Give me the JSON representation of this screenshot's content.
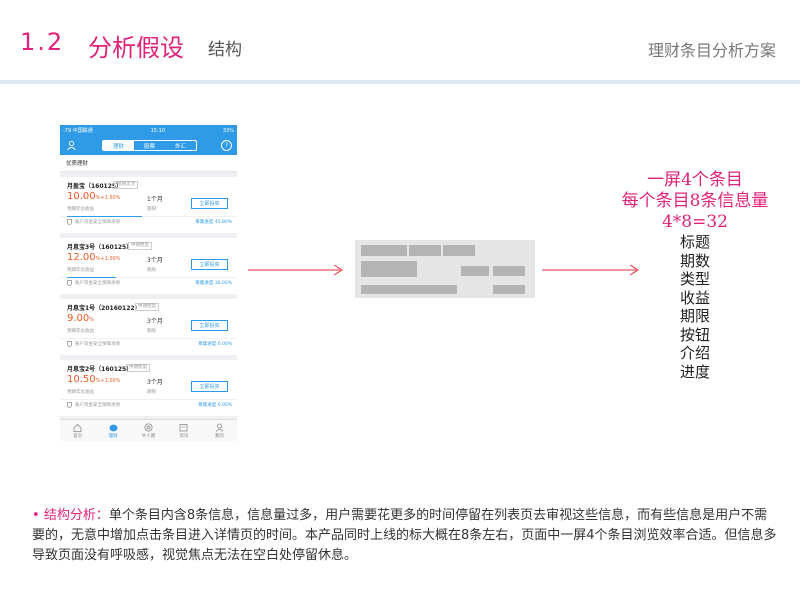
{
  "header": {
    "number": "1.2",
    "title": "分析假设",
    "subtitle": "结构",
    "deck_name": "理财条目分析方案",
    "accent_color": "#e0237a"
  },
  "phone": {
    "status_bar": {
      "carrier": "-79 中国联通",
      "time": "15:10",
      "battery": "33%"
    },
    "tabs": [
      {
        "label": "理财",
        "active": true
      },
      {
        "label": "股票",
        "active": false
      },
      {
        "label": "外汇",
        "active": false
      }
    ],
    "help_icon_text": "?",
    "section_title": "优质理财",
    "products": [
      {
        "name": "月盈宝（160125）",
        "tag": "短期灵活",
        "rate": "10.00",
        "rate_extra": "%+1.50%",
        "rate_label": "预期年化收益",
        "period": "1个月",
        "period_label": "期限",
        "button": "立即投资",
        "insurance": "账户资金安全保障承保",
        "progress": "筹集进度 45.80%",
        "progress_value": 0.458
      },
      {
        "name": "月息宝3号（160125）",
        "tag": "中期稳盈",
        "rate": "12.00",
        "rate_extra": "%+1.00%",
        "rate_label": "预期年化收益",
        "period": "3个月",
        "period_label": "期限",
        "button": "立即投资",
        "insurance": "账户资金安全保障承保",
        "progress": "筹集进度 30.00%",
        "progress_value": 0.3
      },
      {
        "name": "月息宝1号（20160122）",
        "tag": "中期稳盈",
        "rate": "9.00",
        "rate_extra": "%",
        "rate_label": "预期年化收益",
        "period": "3个月",
        "period_label": "期限",
        "button": "立即投资",
        "insurance": "账户资金安全保障承保",
        "progress": "筹集进度 0.00%",
        "progress_value": 0.0
      },
      {
        "name": "月息宝2号（160125）",
        "tag": "中期稳盈",
        "rate": "10.50",
        "rate_extra": "%+1.00%",
        "rate_label": "预期年化收益",
        "period": "3个月",
        "period_label": "期限",
        "button": "立即投资",
        "insurance": "账户资金安全保障承保",
        "progress": "筹集进度 0.00%",
        "progress_value": 0.0
      }
    ],
    "tabbar": [
      {
        "label": "首页",
        "icon": "home-icon",
        "active": false
      },
      {
        "label": "理财",
        "icon": "piggy-bank-icon",
        "active": true
      },
      {
        "label": "牛人圈",
        "icon": "circle-icon",
        "active": false
      },
      {
        "label": "资讯",
        "icon": "news-icon",
        "active": false
      },
      {
        "label": "我的",
        "icon": "user-icon",
        "active": false
      }
    ],
    "brand_color": "#2f9be6",
    "rate_color": "#f15a24"
  },
  "annotation": {
    "line1": "一屏4个条目",
    "line2": "每个条目8条信息量",
    "line3": "4*8=32",
    "fields": [
      "标题",
      "期数",
      "类型",
      "收益",
      "期限",
      "按钮",
      "介绍",
      "进度"
    ]
  },
  "analysis": {
    "bullet": "•",
    "label": "结构分析：",
    "text": "单个条目内含8条信息，信息量过多，用户需要花更多的时间停留在列表页去审视这些信息，而有些信息是用户不需要的，无意中增加点击条目进入详情页的时间。本产品同时上线的标大概在8条左右，页面中一屏4个条目浏览效率合适。但信息多导致页面没有呼吸感，视觉焦点无法在空白处停留休息。"
  }
}
